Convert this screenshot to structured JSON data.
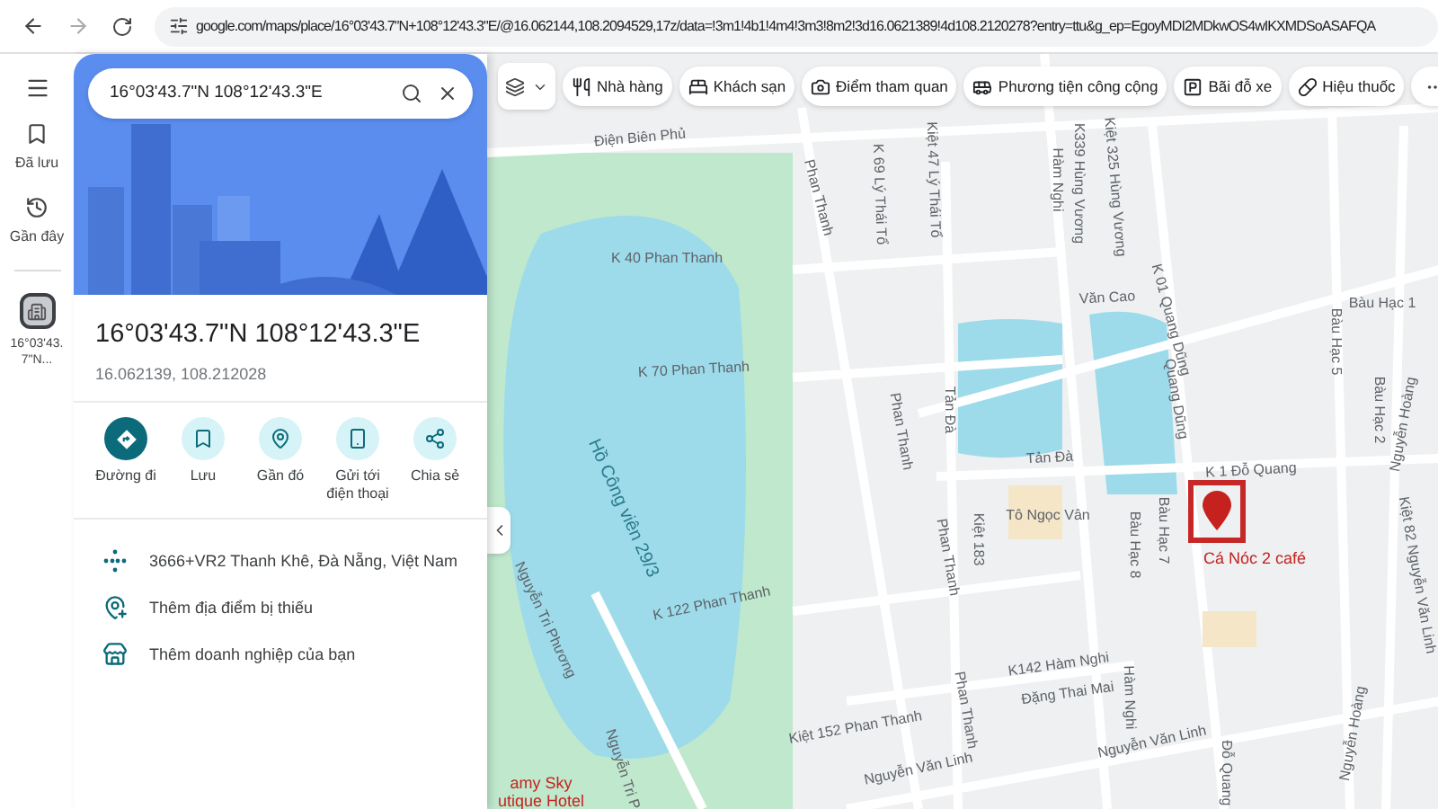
{
  "browser": {
    "url": "google.com/maps/place/16°03'43.7\"N+108°12'43.3\"E/@16.062144,108.2094529,17z/data=!3m1!4b1!4m4!3m3!8m2!3d16.0621389!4d108.2120278?entry=ttu&g_ep=EgoyMDI2MDkwOS4wIKXMDSoASAFQA"
  },
  "rail": {
    "items": [
      {
        "label": "Đã lưu",
        "kind": "saved"
      },
      {
        "label": "Gần đây",
        "kind": "recent"
      }
    ],
    "recent_place": "16°03'43.7\"N..."
  },
  "panel": {
    "search": {
      "value": "16°03'43.7\"N 108°12'43.3\"E"
    },
    "title": "16°03'43.7\"N 108°12'43.3\"E",
    "coordinates": "16.062139, 108.212028",
    "actions": [
      {
        "label": "Đường đi",
        "kind": "directions",
        "selected": true
      },
      {
        "label": "Lưu",
        "kind": "save",
        "selected": false
      },
      {
        "label": "Gần đó",
        "kind": "nearby",
        "selected": false
      },
      {
        "label": "Gửi tới điện thoại",
        "kind": "phone",
        "selected": false
      },
      {
        "label": "Chia sẻ",
        "kind": "share",
        "selected": false
      }
    ],
    "details": [
      {
        "kind": "plus-code",
        "text": "3666+VR2 Thanh Khê, Đà Nẵng, Việt Nam"
      },
      {
        "kind": "add-place",
        "text": "Thêm địa điểm bị thiếu"
      },
      {
        "kind": "add-business",
        "text": "Thêm doanh nghiệp của bạn"
      }
    ]
  },
  "map": {
    "chips": [
      {
        "label": "Nhà hàng",
        "kind": "restaurant"
      },
      {
        "label": "Khách sạn",
        "kind": "hotel"
      },
      {
        "label": "Điểm tham quan",
        "kind": "attraction"
      },
      {
        "label": "Phương tiện công cộng",
        "kind": "transit"
      },
      {
        "label": "Bãi đỗ xe",
        "kind": "parking"
      },
      {
        "label": "Hiệu thuốc",
        "kind": "pharmacy"
      }
    ],
    "labels": [
      {
        "text": "Điện Biên Phủ",
        "kind": "road"
      },
      {
        "text": "Phan Thanh",
        "kind": "road"
      },
      {
        "text": "K 69 Lý Thái Tổ",
        "kind": "road"
      },
      {
        "text": "Kiệt 47 Lý Thái Tổ",
        "kind": "road"
      },
      {
        "text": "Hàm Nghi",
        "kind": "road"
      },
      {
        "text": "K339 Hùng Vương",
        "kind": "road"
      },
      {
        "text": "Kiệt 325 Hùng Vương",
        "kind": "road"
      },
      {
        "text": "K 40 Phan Thanh",
        "kind": "road"
      },
      {
        "text": "Văn Cao",
        "kind": "road"
      },
      {
        "text": "K 01 Quang Dũng",
        "kind": "road"
      },
      {
        "text": "Quang Dũng",
        "kind": "road"
      },
      {
        "text": "Bàu Hạc 1",
        "kind": "road"
      },
      {
        "text": "Bàu Hạc 5",
        "kind": "road"
      },
      {
        "text": "Bàu Hạc 2",
        "kind": "road"
      },
      {
        "text": "K 70 Phan Thanh",
        "kind": "road"
      },
      {
        "text": "Tản Đà",
        "kind": "road"
      },
      {
        "text": "Phan Thanh",
        "kind": "road"
      },
      {
        "text": "Hồ Công viên 29/3",
        "kind": "water"
      },
      {
        "text": "Tản Đà",
        "kind": "road"
      },
      {
        "text": "K 1 Đỗ Quang",
        "kind": "road"
      },
      {
        "text": "Tô Ngọc Vân",
        "kind": "road"
      },
      {
        "text": "Bàu Hạc 8",
        "kind": "road"
      },
      {
        "text": "Bàu Hạc 7",
        "kind": "road"
      },
      {
        "text": "Cá Nóc 2 café",
        "kind": "poi"
      },
      {
        "text": "Kiệt 183",
        "kind": "road"
      },
      {
        "text": "K 122 Phan Thanh",
        "kind": "road"
      },
      {
        "text": "Phan Thanh",
        "kind": "road"
      },
      {
        "text": "K142 Hàm Nghi",
        "kind": "road"
      },
      {
        "text": "Đặng Thai Mai",
        "kind": "road"
      },
      {
        "text": "Hàm Nghi",
        "kind": "road"
      },
      {
        "text": "Kiệt 152 Phan Thanh",
        "kind": "road"
      },
      {
        "text": "Phan Thanh",
        "kind": "road"
      },
      {
        "text": "Nguyễn Văn Linh",
        "kind": "road"
      },
      {
        "text": "Nguyễn Văn Linh",
        "kind": "road"
      },
      {
        "text": "Nguyễn Tri Phương",
        "kind": "road"
      },
      {
        "text": "Nguyễn Tri P",
        "kind": "road"
      },
      {
        "text": "Nguyễn Hoàng",
        "kind": "road"
      },
      {
        "text": "Kiệt 82 Nguyễn Văn Linh",
        "kind": "road"
      },
      {
        "text": "Đỗ Quang",
        "kind": "road"
      },
      {
        "text": "Nguyễn Hoàng",
        "kind": "road"
      },
      {
        "text": "amy Sky",
        "kind": "poi"
      },
      {
        "text": "utique Hotel",
        "kind": "poi"
      }
    ],
    "pin_highlighted": true
  }
}
